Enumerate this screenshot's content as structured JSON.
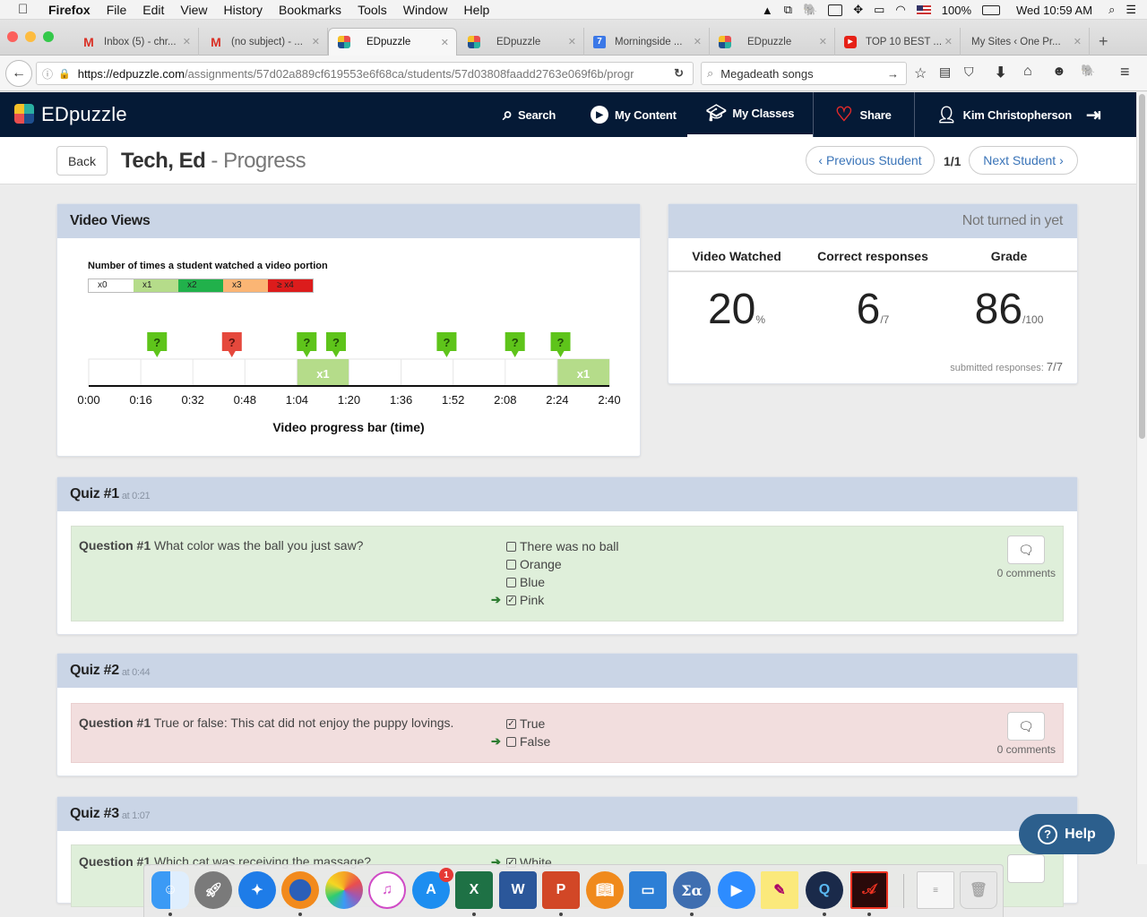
{
  "menubar": {
    "app": "Firefox",
    "items": [
      "File",
      "Edit",
      "View",
      "History",
      "Bookmarks",
      "Tools",
      "Window",
      "Help"
    ],
    "battery": "100%",
    "clock": "Wed 10:59 AM"
  },
  "tabs": [
    {
      "label": "Inbox (5) - chr...",
      "icon": "gmail-icon"
    },
    {
      "label": "(no subject) - ...",
      "icon": "gmail-icon"
    },
    {
      "label": "EDpuzzle",
      "icon": "edpuzzle-icon",
      "active": true
    },
    {
      "label": "EDpuzzle",
      "icon": "edpuzzle-icon"
    },
    {
      "label": "Morningside ...",
      "icon": "calendar-icon",
      "badge": "7"
    },
    {
      "label": "EDpuzzle",
      "icon": "edpuzzle-icon"
    },
    {
      "label": "TOP 10 BEST ...",
      "icon": "youtube-icon"
    },
    {
      "label": "My Sites ‹ One Pr...",
      "icon": "none"
    }
  ],
  "navbar": {
    "url_domain": "https://edpuzzle.com",
    "url_path": "/assignments/57d02a889cf619553e6f68ca/students/57d03808faadd2763e069f6b/progr",
    "search_value": "Megadeath songs"
  },
  "app": {
    "brand": "EDpuzzle",
    "nav": {
      "search": "Search",
      "my_content": "My Content",
      "my_classes": "My Classes",
      "share": "Share",
      "user": "Kim Christopherson"
    },
    "back_label": "Back",
    "student_name": "Tech, Ed",
    "title_suffix": "- Progress",
    "prev_student": "‹ Previous Student",
    "page_counter": "1/1",
    "next_student": "Next Student ›",
    "colors": {
      "header_bg": "#051a36",
      "panel_head": "#cad5e6",
      "correct_bg": "#dfefda",
      "wrong_bg": "#f2dede",
      "accent": "#3a74b8"
    }
  },
  "video_views": {
    "title": "Video Views",
    "legend_title": "Number of times a student watched a video portion",
    "legend": [
      {
        "label": "x0",
        "color": "#ffffff"
      },
      {
        "label": "x1",
        "color": "#b5dc8a"
      },
      {
        "label": "x2",
        "color": "#21b14b"
      },
      {
        "label": "x3",
        "color": "#fbb574"
      },
      {
        "label": "≥ x4",
        "color": "#dc1c1c"
      }
    ],
    "ticks": [
      "0:00",
      "0:16",
      "0:32",
      "0:48",
      "1:04",
      "1:20",
      "1:36",
      "1:52",
      "2:08",
      "2:24",
      "2:40"
    ],
    "duration_seconds": 160,
    "segments": [
      {
        "start": 64,
        "end": 80,
        "views": 1,
        "label": "x1"
      },
      {
        "start": 144,
        "end": 160,
        "views": 1,
        "label": "x1"
      }
    ],
    "markers": [
      {
        "time": 21,
        "status": "correct"
      },
      {
        "time": 44,
        "status": "wrong"
      },
      {
        "time": 67,
        "status": "correct"
      },
      {
        "time": 76,
        "status": "correct"
      },
      {
        "time": 110,
        "status": "correct"
      },
      {
        "time": 131,
        "status": "correct"
      },
      {
        "time": 145,
        "status": "correct"
      }
    ],
    "marker_glyph": "?",
    "xlabel": "Video progress bar (time)"
  },
  "summary": {
    "status": "Not turned in yet",
    "headers": [
      "Video Watched",
      "Correct responses",
      "Grade"
    ],
    "video_watched": {
      "value": "20",
      "unit": "%"
    },
    "correct": {
      "value": "6",
      "unit": "/7"
    },
    "grade": {
      "value": "86",
      "unit": "/100"
    },
    "submitted_label": "submitted responses:",
    "submitted_value": "7/7"
  },
  "quizzes": [
    {
      "title": "Quiz #1",
      "at": "at 0:21",
      "question_label": "Question #1",
      "question": "What color was the ball you just saw?",
      "result": "correct",
      "options": [
        {
          "text": "There was no ball",
          "checked": false,
          "correct": false
        },
        {
          "text": "Orange",
          "checked": false,
          "correct": false
        },
        {
          "text": "Blue",
          "checked": false,
          "correct": false
        },
        {
          "text": "Pink",
          "checked": true,
          "correct": true
        }
      ],
      "comments": "0 comments"
    },
    {
      "title": "Quiz #2",
      "at": "at 0:44",
      "question_label": "Question #1",
      "question": "True or false: This cat did not enjoy the puppy lovings.",
      "result": "wrong",
      "options": [
        {
          "text": "True",
          "checked": true,
          "correct": false
        },
        {
          "text": "False",
          "checked": false,
          "correct": true
        }
      ],
      "comments": "0 comments"
    },
    {
      "title": "Quiz #3",
      "at": "at 1:07",
      "question_label": "Question #1",
      "question": "Which cat was receiving the massage?",
      "result": "correct",
      "options": [
        {
          "text": "White",
          "checked": true,
          "correct": true
        }
      ]
    }
  ],
  "help_label": "Help",
  "dock": {
    "apps": [
      "Finder",
      "Launchpad",
      "Safari",
      "Firefox",
      "Photos",
      "iTunes",
      "App Store",
      "Excel",
      "Word",
      "PowerPoint",
      "iBooks",
      "Keynote",
      "Sigma",
      "Zoom",
      "Stickies",
      "QuickTime",
      "Acrobat",
      "Document",
      "Trash"
    ],
    "app_store_badge": "1"
  }
}
